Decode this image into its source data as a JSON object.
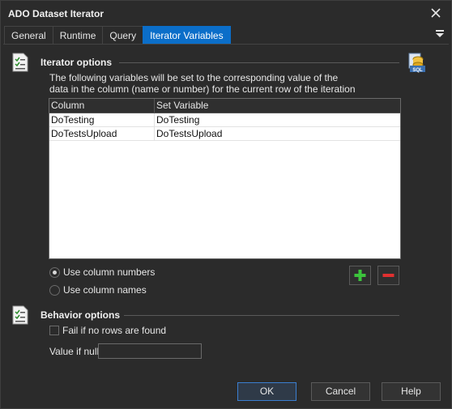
{
  "window": {
    "title": "ADO Dataset Iterator"
  },
  "tabs": [
    {
      "label": "General"
    },
    {
      "label": "Runtime"
    },
    {
      "label": "Query"
    },
    {
      "label": "Iterator Variables"
    }
  ],
  "active_tab": "Iterator Variables",
  "iterator_options": {
    "title": "Iterator options",
    "description": "The following variables will be set to the corresponding value of the data in the column (name or number) for the current row of the iteration",
    "table": {
      "columns": [
        "Column",
        "Set Variable"
      ],
      "rows": [
        [
          "DoTesting",
          "DoTesting"
        ],
        [
          "DoTestsUpload",
          "DoTestsUpload"
        ]
      ]
    },
    "radio_numbers": {
      "label": "Use column numbers",
      "checked": true
    },
    "radio_names": {
      "label": "Use column names",
      "checked": false
    }
  },
  "behavior_options": {
    "title": "Behavior options",
    "fail_checkbox": {
      "label": "Fail if no rows are found",
      "checked": false
    },
    "null_label": "Value if null",
    "null_value": ""
  },
  "footer": {
    "ok": "OK",
    "cancel": "Cancel",
    "help": "Help"
  },
  "colors": {
    "accent": "#0b6ec9",
    "background": "#2b2b2b",
    "add_green": "#3cc43c",
    "remove_red": "#e03030"
  }
}
